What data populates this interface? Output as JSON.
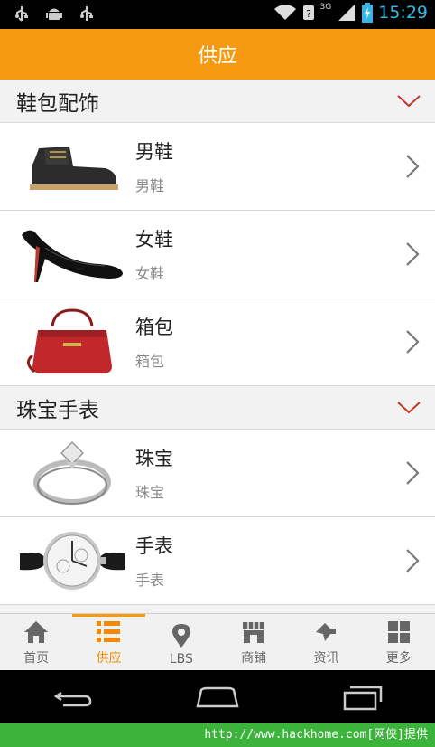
{
  "status_bar": {
    "time": "15:29",
    "network": "3G"
  },
  "app_bar": {
    "title": "供应"
  },
  "sections": [
    {
      "title": "鞋包配饰",
      "items": [
        {
          "name": "男鞋",
          "subtitle": "男鞋",
          "image": "mens-boot"
        },
        {
          "name": "女鞋",
          "subtitle": "女鞋",
          "image": "womens-heel"
        },
        {
          "name": "箱包",
          "subtitle": "箱包",
          "image": "handbag"
        }
      ]
    },
    {
      "title": "珠宝手表",
      "items": [
        {
          "name": "珠宝",
          "subtitle": "珠宝",
          "image": "diamond-ring"
        },
        {
          "name": "手表",
          "subtitle": "手表",
          "image": "wristwatch"
        }
      ]
    }
  ],
  "tabs": [
    {
      "label": "首页",
      "icon": "home-icon"
    },
    {
      "label": "供应",
      "icon": "list-icon",
      "active": true
    },
    {
      "label": "LBS",
      "icon": "location-pin-icon"
    },
    {
      "label": "商铺",
      "icon": "shop-icon"
    },
    {
      "label": "资讯",
      "icon": "news-icon"
    },
    {
      "label": "更多",
      "icon": "grid-icon"
    }
  ],
  "watermark": "http://www.hackhome.com[网侠]提供",
  "colors": {
    "accent": "#f59a10",
    "chevron_section": "#c0392b",
    "time": "#35b6e6"
  }
}
